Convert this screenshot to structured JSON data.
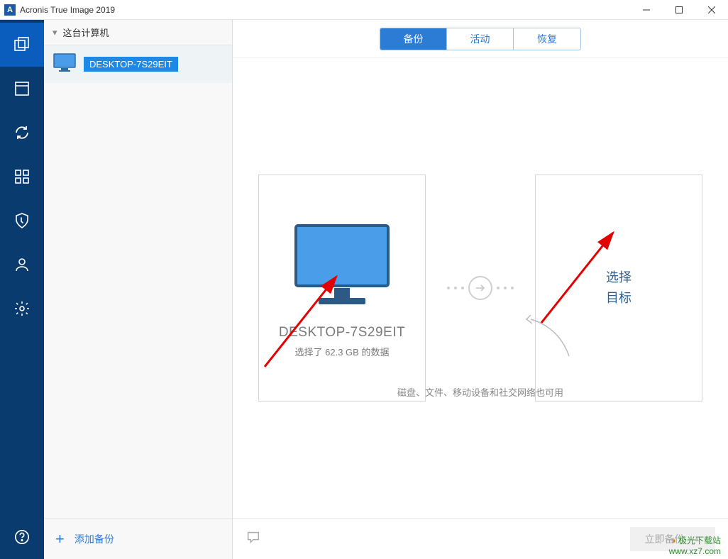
{
  "titlebar": {
    "app_logo_letter": "A",
    "title": "Acronis True Image 2019"
  },
  "sidebar": {
    "header_label": "这台计算机",
    "items": [
      {
        "name": "DESKTOP-7S29EIT"
      }
    ],
    "add_backup_label": "添加备份"
  },
  "tabs": {
    "backup": "备份",
    "activity": "活动",
    "restore": "恢复"
  },
  "source_card": {
    "title": "DESKTOP-7S29EIT",
    "subtitle": "选择了 62.3 GB 的数据"
  },
  "target_card": {
    "line1": "选择",
    "line2": "目标"
  },
  "hint": "磁盘、文件、移动设备和社交网络也可用",
  "bottom": {
    "backup_now": "立即备份"
  },
  "watermark": {
    "site": "极光下载站",
    "url": "www.xz7.com"
  },
  "chevron_down": "▾",
  "plus": "+"
}
